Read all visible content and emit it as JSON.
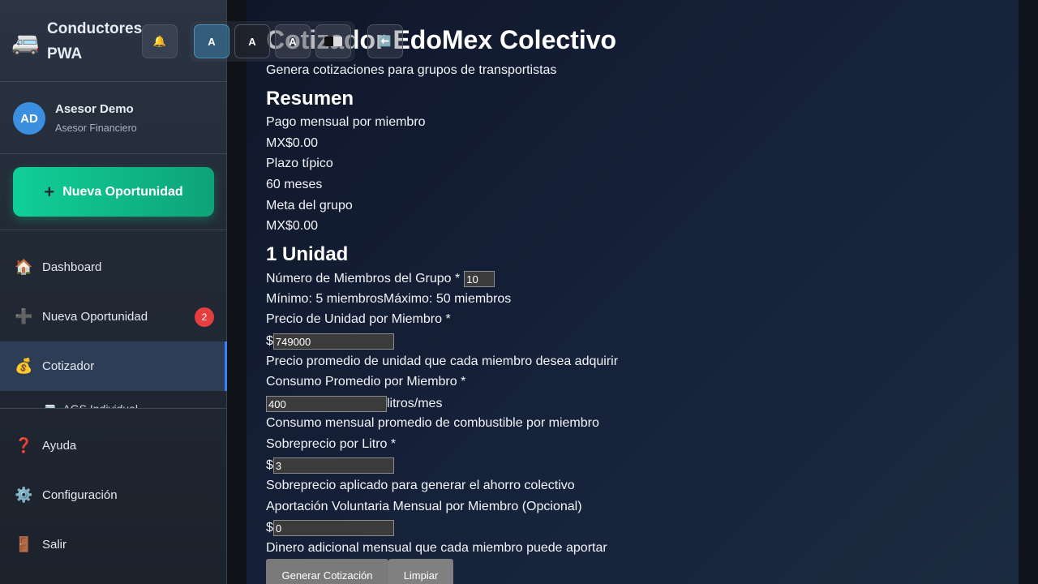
{
  "app": {
    "brand_line1": "Conductores",
    "brand_line2": "PWA",
    "brand_icon": "van-icon"
  },
  "profile": {
    "initials": "AD",
    "name": "Asesor Demo",
    "role": "Asesor Financiero"
  },
  "cta": {
    "label": "Nueva Oportunidad",
    "icon": "+"
  },
  "nav": {
    "items": [
      {
        "label": "Dashboard",
        "icon": "🏠"
      },
      {
        "label": "Nueva Oportunidad",
        "icon": "➕",
        "badge": "2"
      },
      {
        "label": "Cotizador",
        "icon": "💰"
      }
    ],
    "sub_label": "AGS Individual",
    "sub_icon": "🚐",
    "bottom": [
      {
        "label": "Ayuda",
        "icon": "❓"
      },
      {
        "label": "Configuración",
        "icon": "⚙️"
      },
      {
        "label": "Salir",
        "icon": "🚪"
      }
    ]
  },
  "toolbar": {
    "bell_icon": "🔔",
    "a11y_buttons": [
      "A",
      "A",
      "A",
      ""
    ],
    "back_icon": "⬅️"
  },
  "main": {
    "title": "Cotizador EdoMex Colectivo",
    "subtitle": "Genera cotizaciones para grupos de transportistas",
    "summary_heading": "Resumen",
    "summary": [
      "Pago mensual por miembro",
      "MX$0.00",
      "Plazo típico",
      "60 meses",
      "Meta del grupo",
      "MX$0.00"
    ],
    "units_heading": "1 Unidad",
    "members_label": "Número de Miembros del Grupo *",
    "members_value": "10",
    "members_hint": "Mínimo: 5 miembrosMáximo: 50 miembros",
    "price_label": "Precio de Unidad por Miembro *",
    "currency": "$",
    "price_value": "749000",
    "price_hint": "Precio promedio de unidad que cada miembro desea adquirir",
    "consumption_label": "Consumo Promedio por Miembro *",
    "consumption_value": "400",
    "consumption_unit": "litros/mes",
    "consumption_hint": "Consumo mensual promedio de combustible por miembro",
    "surcharge_label": "Sobreprecio por Litro *",
    "surcharge_value": "3",
    "surcharge_hint": "Sobreprecio aplicado para generar el ahorro colectivo",
    "voluntary_label": "Aportación Voluntaria Mensual por Miembro (Opcional)",
    "voluntary_value": "0",
    "voluntary_hint": "Dinero adicional mensual que cada miembro puede aportar",
    "generate_button": "Generar Cotización",
    "clear_button": "Limpiar"
  }
}
